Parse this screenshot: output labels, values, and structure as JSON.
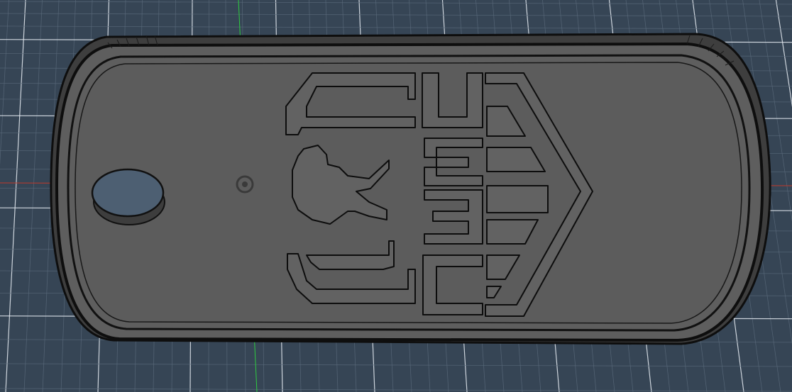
{
  "viewport": {
    "background_color": "#364555",
    "grid_minor_color": "#5b6b7c",
    "grid_major_color": "#dfe5ec",
    "x_axis_color": "#c0392b",
    "y_axis_color": "#2ecc40"
  },
  "model": {
    "tag_body_color": "#5e5e5e",
    "tag_edge_color": "#111111",
    "rim_color": "#4a4a4a",
    "emblem_color": "#626262",
    "hole_color": "#4d5f72",
    "emblem_letters": [
      "U",
      "S",
      "E",
      "C"
    ]
  },
  "icons": {
    "origin_gizmo": "origin-target-icon",
    "key_hole": "keyring-hole-icon"
  }
}
